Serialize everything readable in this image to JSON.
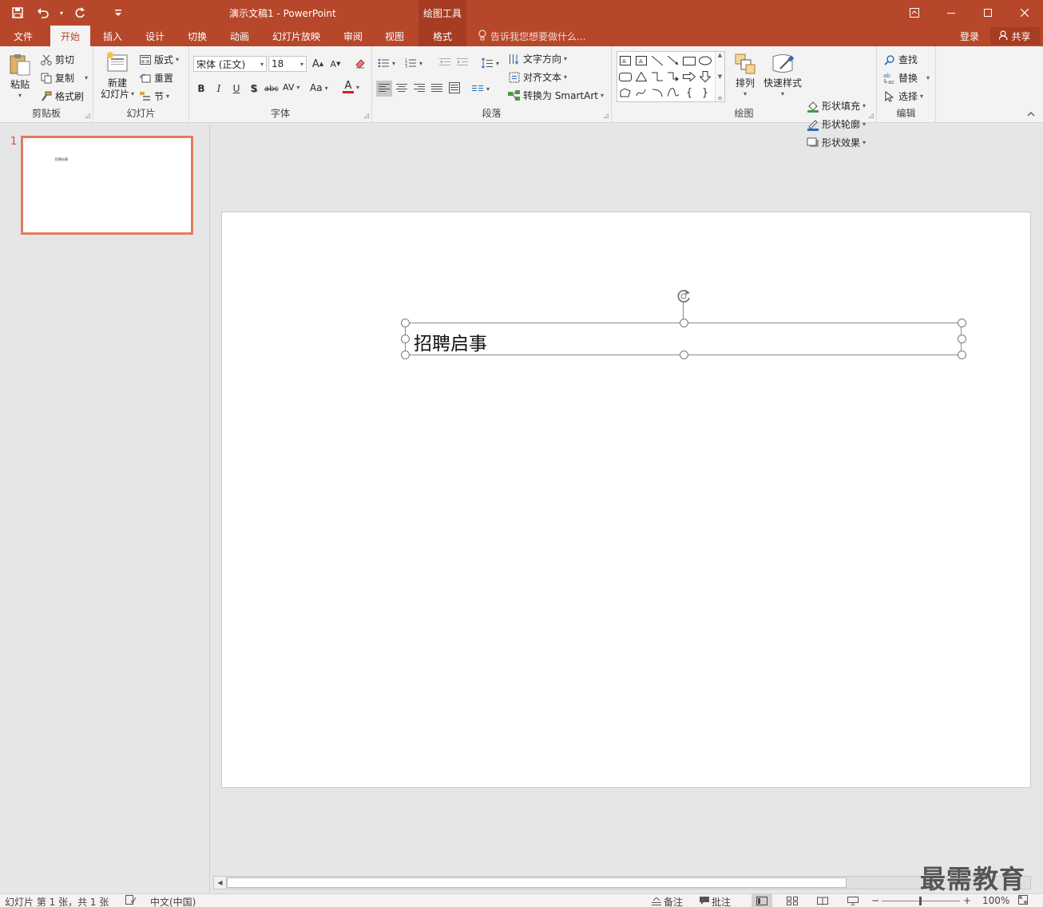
{
  "titlebar": {
    "doc_title": "演示文稿1 - PowerPoint",
    "context_group": "绘图工具",
    "qat": [
      {
        "name": "save-icon",
        "glyph": "💾"
      },
      {
        "name": "undo-icon",
        "glyph": "↶"
      },
      {
        "name": "undo-dropdown-icon",
        "glyph": "▾"
      },
      {
        "name": "redo-icon",
        "glyph": "↻"
      },
      {
        "name": "customize-qat-icon",
        "glyph": "≡"
      }
    ],
    "window_controls": [
      {
        "name": "ribbon-display-options-icon",
        "glyph": "⊡"
      },
      {
        "name": "minimize-icon",
        "glyph": "—"
      },
      {
        "name": "maximize-icon",
        "glyph": "☐"
      },
      {
        "name": "close-icon",
        "glyph": "✕"
      }
    ]
  },
  "tabs": [
    {
      "id": "file",
      "label": "文件"
    },
    {
      "id": "home",
      "label": "开始"
    },
    {
      "id": "insert",
      "label": "插入"
    },
    {
      "id": "design",
      "label": "设计"
    },
    {
      "id": "transitions",
      "label": "切换"
    },
    {
      "id": "animations",
      "label": "动画"
    },
    {
      "id": "slideshow",
      "label": "幻灯片放映"
    },
    {
      "id": "review",
      "label": "审阅"
    },
    {
      "id": "view",
      "label": "视图"
    },
    {
      "id": "format",
      "label": "格式"
    }
  ],
  "tellme": "告诉我您想要做什么...",
  "account": {
    "login": "登录",
    "share": "共享"
  },
  "ribbon": {
    "clipboard": {
      "label": "剪贴板",
      "paste": "粘贴",
      "cut": "剪切",
      "copy": "复制",
      "format_painter": "格式刷"
    },
    "slides": {
      "label": "幻灯片",
      "new_slide_line1": "新建",
      "new_slide_line2": "幻灯片",
      "layout": "版式",
      "reset": "重置",
      "section": "节"
    },
    "font": {
      "label": "字体",
      "font_name": "宋体 (正文)",
      "font_size": "18",
      "bold": "B",
      "italic": "I",
      "underline": "U",
      "shadow": "S",
      "strikethrough": "abc",
      "spacing": "AV",
      "change_case": "Aa",
      "font_color": "A",
      "grow": "A",
      "shrink": "A"
    },
    "paragraph": {
      "label": "段落",
      "text_direction": "文字方向",
      "align_text": "对齐文本",
      "smartart": "转换为 SmartArt"
    },
    "drawing": {
      "label": "绘图",
      "arrange": "排列",
      "quick_styles": "快速样式",
      "shape_fill": "形状填充",
      "shape_outline": "形状轮廓",
      "shape_effects": "形状效果"
    },
    "editing": {
      "label": "编辑",
      "find": "查找",
      "replace": "替换",
      "select": "选择"
    }
  },
  "thumbnails": [
    {
      "number": "1",
      "text": "招聘启事"
    }
  ],
  "slide": {
    "textbox_text": "招聘启事"
  },
  "watermark": "最需教育",
  "statusbar": {
    "slide_info": "幻灯片 第 1 张，共 1 张",
    "language": "中文(中国)",
    "notes": "备注",
    "comments": "批注",
    "zoom": "100%"
  },
  "colors": {
    "accent": "#b7472a",
    "context_tab": "#a63c22",
    "ribbon_bg": "#f3f3f3",
    "workspace_bg": "#e6e6e6",
    "thumb_border": "#e87a5c"
  }
}
